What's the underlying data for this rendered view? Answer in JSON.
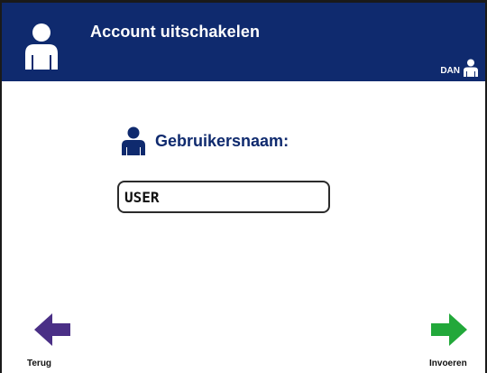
{
  "header": {
    "title": "Account uitschakelen",
    "icon": "user-icon",
    "background_color": "#0f2a6e",
    "current_user": "DAN",
    "current_user_icon": "user-icon"
  },
  "form": {
    "field_label": "Gebruikersnaam:",
    "field_icon": "user-icon",
    "username_value": "USER",
    "accent_color": "#0f2a6e"
  },
  "navigation": {
    "back_label": "Terug",
    "back_icon": "arrow-left-icon",
    "back_color": "#4a2f86",
    "next_label": "Invoeren",
    "next_icon": "arrow-right-icon",
    "next_color": "#22a83a"
  }
}
